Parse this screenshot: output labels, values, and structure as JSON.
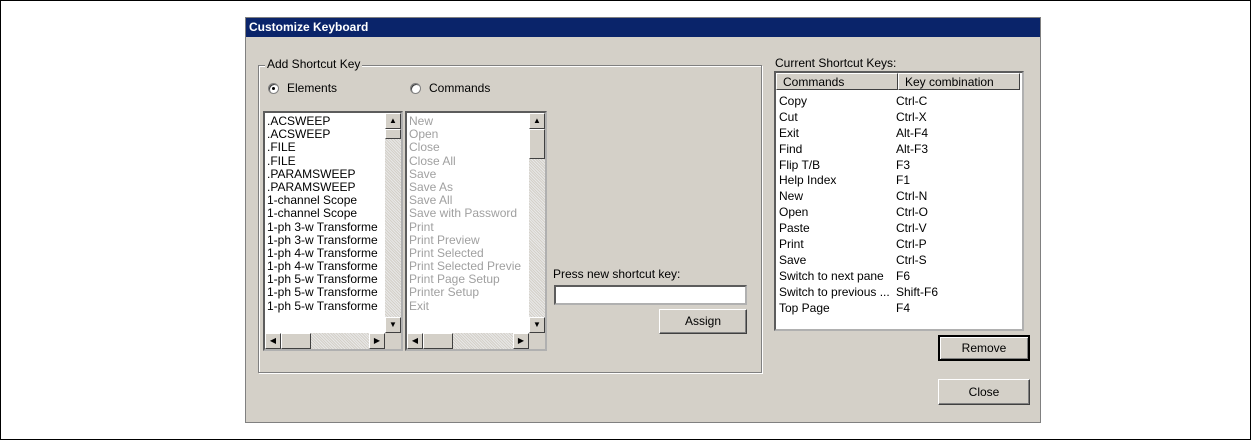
{
  "dialog": {
    "title": "Customize Keyboard",
    "add_group_label": "Add Shortcut Key",
    "radio_elements": "Elements",
    "radio_commands": "Commands",
    "elements_list": [
      ".ACSWEEP",
      ".ACSWEEP",
      ".FILE",
      ".FILE",
      ".PARAMSWEEP",
      ".PARAMSWEEP",
      "1-channel Scope",
      "1-channel Scope",
      "1-ph 3-w Transforme",
      "1-ph 3-w Transforme",
      "1-ph 4-w Transforme",
      "1-ph 4-w Transforme",
      "1-ph 5-w Transforme",
      "1-ph 5-w Transforme",
      "1-ph 5-w Transforme"
    ],
    "commands_list": [
      "New",
      "Open",
      "Close",
      "Close All",
      "Save",
      "Save As",
      "Save All",
      "Save with Password",
      "Print",
      "Print Preview",
      "Print Selected",
      "Print Selected Previe",
      "Print Page Setup",
      "Printer Setup",
      "Exit"
    ],
    "new_key_label": "Press new shortcut key:",
    "new_key_value": "",
    "assign_label": "Assign",
    "current_label": "Current Shortcut Keys:",
    "columns": [
      "Commands",
      "Key combination"
    ],
    "shortcuts": [
      [
        "Copy",
        "Ctrl-C"
      ],
      [
        "Cut",
        "Ctrl-X"
      ],
      [
        "Exit",
        "Alt-F4"
      ],
      [
        "Find",
        "Alt-F3"
      ],
      [
        "Flip  T/B",
        "F3"
      ],
      [
        "Help Index",
        "F1"
      ],
      [
        "New",
        "Ctrl-N"
      ],
      [
        "Open",
        "Ctrl-O"
      ],
      [
        "Paste",
        "Ctrl-V"
      ],
      [
        "Print",
        "Ctrl-P"
      ],
      [
        "Save",
        "Ctrl-S"
      ],
      [
        "Switch to next pane",
        "F6"
      ],
      [
        "Switch to previous ...",
        "Shift-F6"
      ],
      [
        "Top Page",
        "F4"
      ]
    ],
    "remove_label": "Remove",
    "close_label": "Close"
  }
}
